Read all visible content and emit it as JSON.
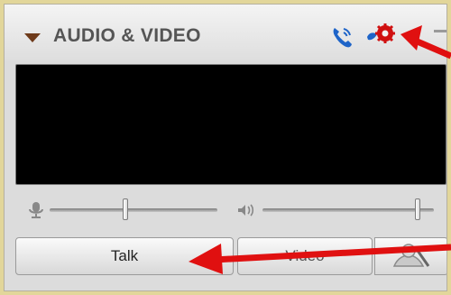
{
  "panel": {
    "title": "AUDIO & VIDEO",
    "icons": {
      "collapse": "triangle-down-icon",
      "phone": "phone-handset-icon",
      "settings": "gear-icon",
      "menu": "menu-icon"
    }
  },
  "audio": {
    "mic_volume": 0.45,
    "speaker_volume": 0.92,
    "icons": {
      "mic": "microphone-icon",
      "speaker": "speaker-icon"
    }
  },
  "buttons": {
    "talk_label": "Talk",
    "video_label": "Video",
    "camera_icon": "camera-icon"
  },
  "colors": {
    "accent_phone": "#1e64c8",
    "accent_settings": "#d01010",
    "annotation_arrow": "#e01010",
    "background": "#e2d69a"
  }
}
